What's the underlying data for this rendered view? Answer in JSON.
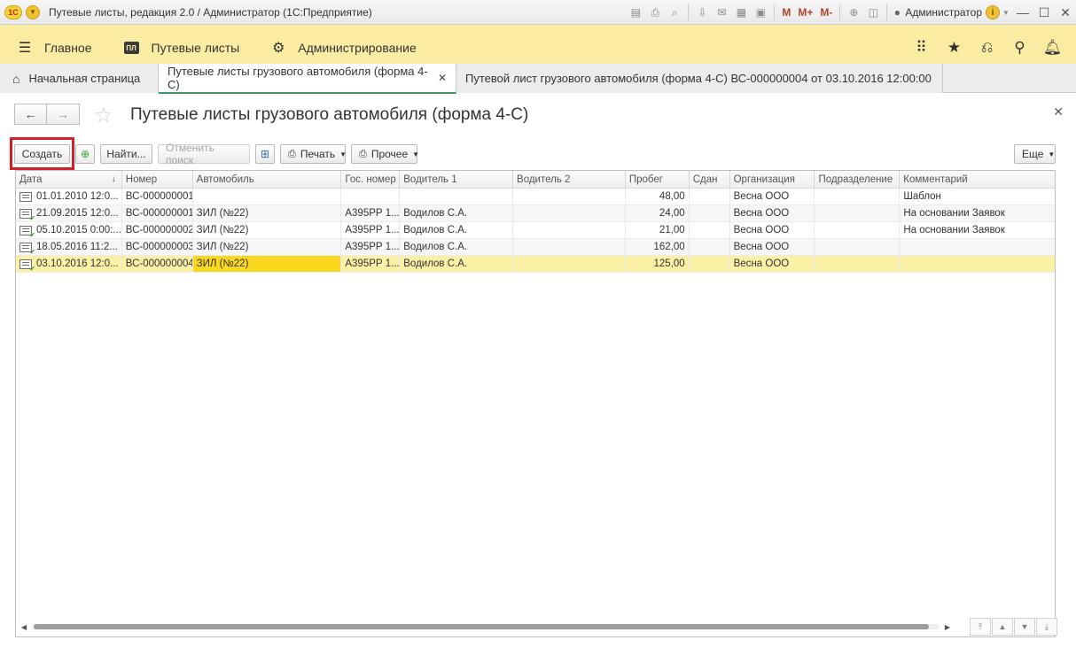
{
  "window": {
    "title": "Путевые листы, редакция 2.0 / Администратор  (1С:Предприятие)",
    "user": "Администратор",
    "toolbar_m": [
      "M",
      "M+",
      "M-"
    ]
  },
  "sections": [
    {
      "label": "Главное",
      "icon": "menu-icon"
    },
    {
      "label": "Путевые листы",
      "icon": "pl-icon",
      "badge": "ПЛ"
    },
    {
      "label": "Администрирование",
      "icon": "gear-icon"
    }
  ],
  "tabs": [
    {
      "label": "Начальная страница",
      "icon": "home-icon"
    },
    {
      "label": "Путевые листы грузового автомобиля (форма 4-С)",
      "active": true
    },
    {
      "label": "Путевой лист грузового автомобиля (форма 4-С) ВС-000000004 от 03.10.2016 12:00:00"
    }
  ],
  "form": {
    "title": "Путевые листы грузового автомобиля (форма 4-С)"
  },
  "commands": {
    "create": "Создать",
    "find": "Найти...",
    "cancel_search": "Отменить поиск",
    "print": "Печать",
    "other": "Прочее",
    "more": "Еще"
  },
  "table": {
    "columns": [
      "Дата",
      "Номер",
      "Автомобиль",
      "Гос. номер",
      "Водитель 1",
      "Водитель 2",
      "Пробег",
      "Сдан",
      "Организация",
      "Подразделение",
      "Комментарий"
    ],
    "rows": [
      {
        "date": "01.01.2010 12:0...",
        "number": "ВС-000000001",
        "car": "",
        "plate": "",
        "driver1": "",
        "driver2": "",
        "mileage": "48,00",
        "handed": "",
        "org": "Весна ООО",
        "dept": "",
        "comment": "Шаблон",
        "posted": false
      },
      {
        "date": "21.09.2015 12:0...",
        "number": "ВС-000000001",
        "car": "ЗИЛ (№22)",
        "plate": "А395РР 1...",
        "driver1": "Водилов С.А.",
        "driver2": "",
        "mileage": "24,00",
        "handed": "",
        "org": "Весна ООО",
        "dept": "",
        "comment": "На основании Заявок",
        "posted": true
      },
      {
        "date": "05.10.2015 0:00:...",
        "number": "ВС-000000002",
        "car": "ЗИЛ (№22)",
        "plate": "А395РР 1...",
        "driver1": "Водилов С.А.",
        "driver2": "",
        "mileage": "21,00",
        "handed": "",
        "org": "Весна ООО",
        "dept": "",
        "comment": "На основании Заявок",
        "posted": true
      },
      {
        "date": "18.05.2016 11:2...",
        "number": "ВС-000000003",
        "car": "ЗИЛ (№22)",
        "plate": "А395РР 1...",
        "driver1": "Водилов С.А.",
        "driver2": "",
        "mileage": "162,00",
        "handed": "",
        "org": "Весна ООО",
        "dept": "",
        "comment": "",
        "posted": true
      },
      {
        "date": "03.10.2016 12:0...",
        "number": "ВС-000000004",
        "car": "ЗИЛ (№22)",
        "plate": "А395РР 1...",
        "driver1": "Водилов С.А.",
        "driver2": "",
        "mileage": "125,00",
        "handed": "",
        "org": "Весна ООО",
        "dept": "",
        "comment": "",
        "posted": true,
        "selected": true
      }
    ]
  },
  "colors": {
    "panel": "#fbeca3",
    "selected_row": "#faf0a6",
    "current_cell": "#f9d81f",
    "highlight_box": "#d0212a",
    "active_tab_line": "#3d9a5a"
  }
}
